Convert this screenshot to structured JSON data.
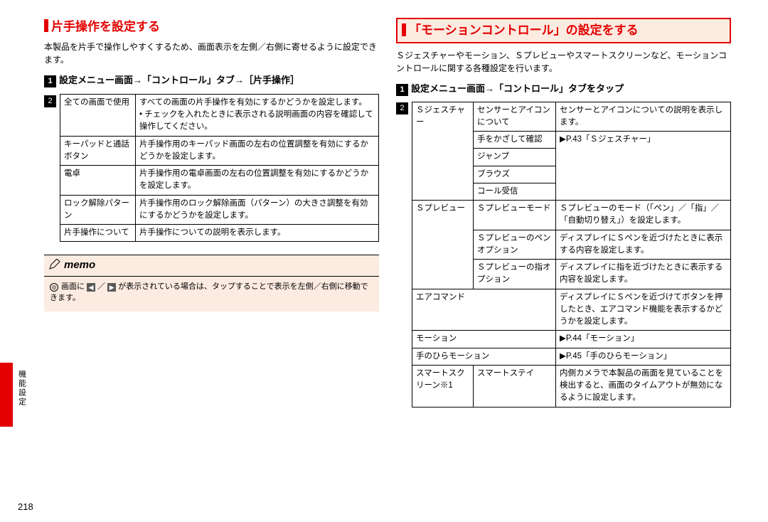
{
  "left": {
    "title": "片手操作を設定する",
    "intro": "本製品を片手で操作しやすくするため、画面表示を左側／右側に寄せるように設定できます。",
    "step1": "設定メニュー画面→「コントロール」タブ→［片手操作］",
    "table": [
      {
        "a": "全ての画面で使用",
        "b": "すべての画面の片手操作を有効にするかどうかを設定します。\n• チェックを入れたときに表示される説明画面の内容を確認して操作してください。"
      },
      {
        "a": "キーパッドと通話ボタン",
        "b": "片手操作用のキーパッド画面の左右の位置調整を有効にするかどうかを設定します。"
      },
      {
        "a": "電卓",
        "b": "片手操作用の電卓画面の左右の位置調整を有効にするかどうかを設定します。"
      },
      {
        "a": "ロック解除パターン",
        "b": "片手操作用のロック解除画面（パターン）の大きさ調整を有効にするかどうかを設定します。"
      },
      {
        "a": "片手操作について",
        "b": "片手操作についての説明を表示します。"
      }
    ],
    "memo_label": "memo",
    "memo_text": "画面に　が表示されている場合は、タップすることで表示を左側／右側に移動できます。"
  },
  "right": {
    "title": "「モーションコントロール」の設定をする",
    "intro": "Ｓジェスチャーやモーション、Ｓプレビューやスマートスクリーンなど、モーションコントロールに関する各種設定を行います。",
    "step1": "設定メニュー画面→「コントロール」タブをタップ",
    "rows": {
      "sg": "Ｓジェスチャー",
      "sg_a": "センサーとアイコンについて",
      "sg_a_d": "センサーとアイコンについての説明を表示します。",
      "sg_b": "手をかざして確認",
      "sg_b_d": "▶P.43「Ｓジェスチャー」",
      "sg_c": "ジャンプ",
      "sg_d": "ブラウズ",
      "sg_e": "コール受信",
      "sp": "Ｓプレビュー",
      "sp_a": "Ｓプレビューモード",
      "sp_a_d": "Ｓプレビューのモード（「ペン」／「指」／「自動切り替え」）を設定します。",
      "sp_b": "Ｓプレビューのペンオプション",
      "sp_b_d": "ディスプレイにＳペンを近づけたときに表示する内容を設定します。",
      "sp_c": "Ｓプレビューの指オプション",
      "sp_c_d": "ディスプレイに指を近づけたときに表示する内容を設定します。",
      "ac": "エアコマンド",
      "ac_d": "ディスプレイにＳペンを近づけてボタンを押したとき、エアコマンド機能を表示するかどうかを設定します。",
      "mo": "モーション",
      "mo_d": "▶P.44「モーション」",
      "pm": "手のひらモーション",
      "pm_d": "▶P.45「手のひらモーション」",
      "ss": "スマートスクリーン※1",
      "ss_a": "スマートステイ",
      "ss_a_d": "内側カメラで本製品の画面を見ていることを検出すると、画面のタイムアウトが無効になるように設定します。"
    }
  },
  "side": "機能設定",
  "pageno": "218"
}
